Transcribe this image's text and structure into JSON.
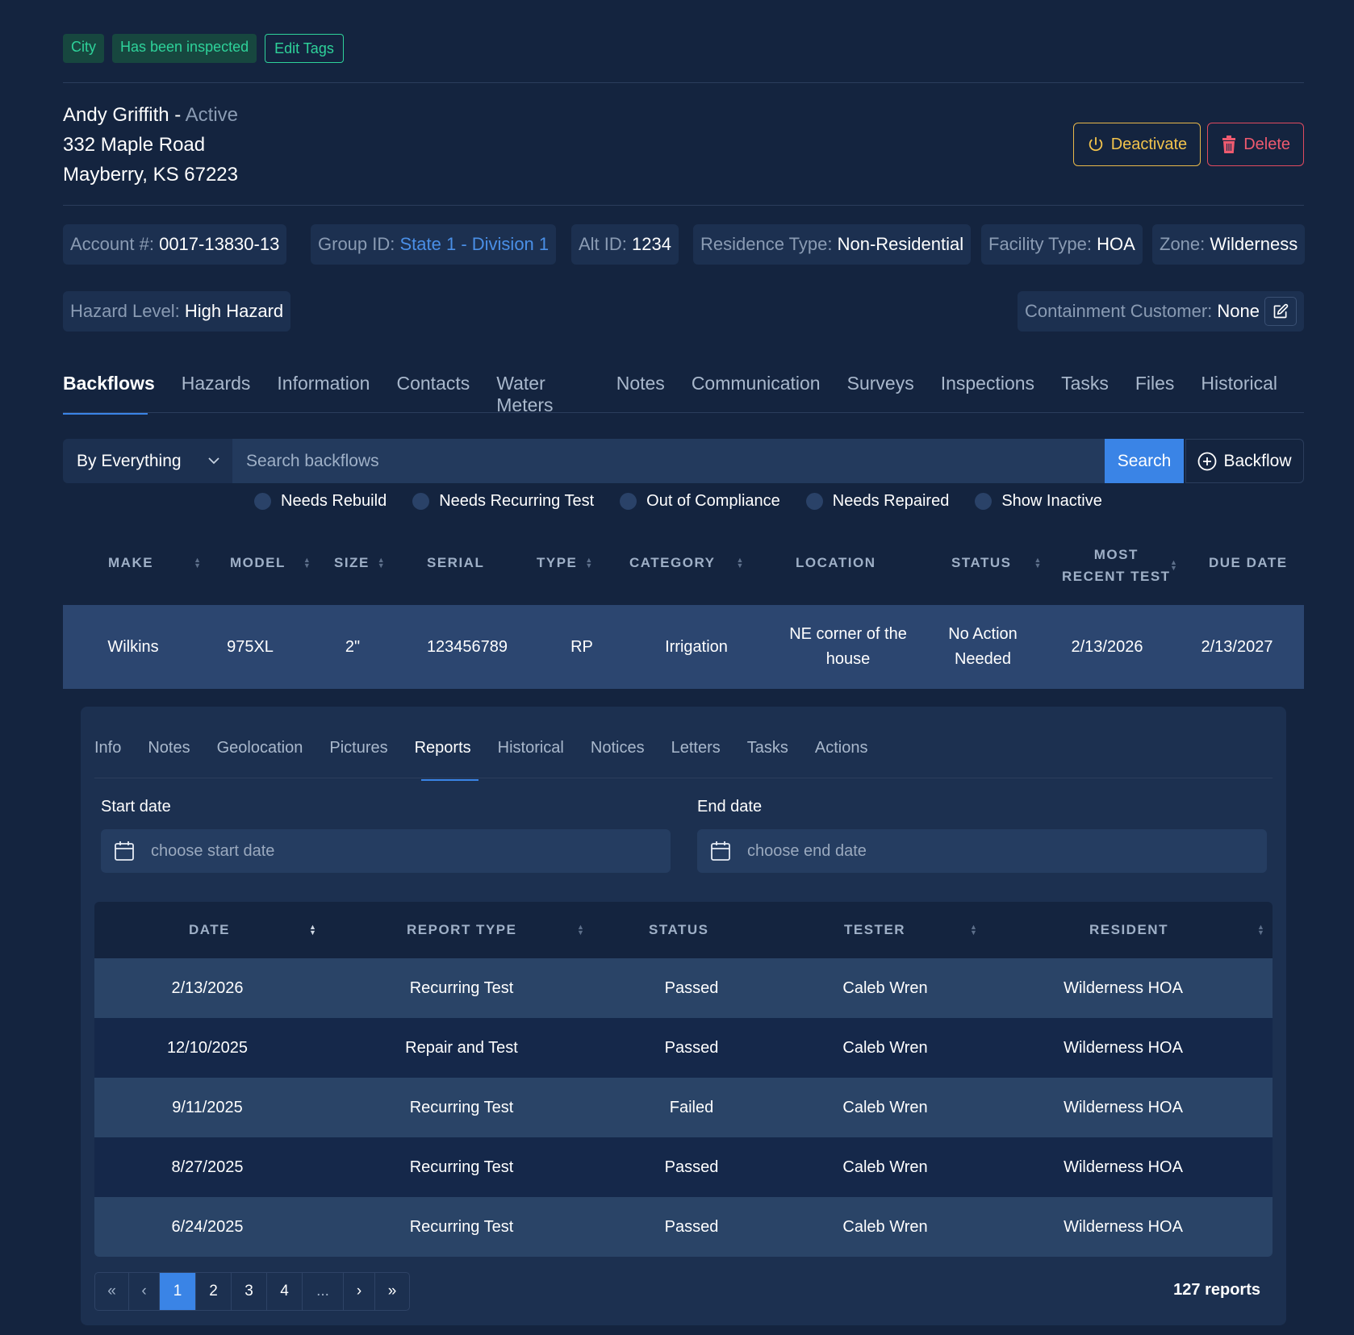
{
  "tags": {
    "items": [
      "City",
      "Has been inspected"
    ],
    "edit_label": "Edit Tags"
  },
  "customer": {
    "name": "Andy Griffith",
    "separator": " - ",
    "status": "Active",
    "address1": "332 Maple Road",
    "address2": "Mayberry, KS 67223"
  },
  "actions": {
    "deactivate": "Deactivate",
    "delete": "Delete"
  },
  "info": {
    "account": {
      "k": "Account #:",
      "v": "0017-13830-13"
    },
    "group": {
      "k": "Group ID:",
      "v": "State 1 - Division 1"
    },
    "alt": {
      "k": "Alt ID:",
      "v": "1234"
    },
    "residence": {
      "k": "Residence Type:",
      "v": "Non-Residential"
    },
    "facility": {
      "k": "Facility Type:",
      "v": "HOA"
    },
    "zone": {
      "k": "Zone:",
      "v": "Wilderness"
    },
    "hazard": {
      "k": "Hazard Level:",
      "v": "High Hazard"
    },
    "containment": {
      "k": "Containment Customer:",
      "v": "None"
    }
  },
  "main_tabs": [
    "Backflows",
    "Hazards",
    "Information",
    "Contacts",
    "Water Meters",
    "Notes",
    "Communication",
    "Surveys",
    "Inspections",
    "Tasks",
    "Files",
    "Historical"
  ],
  "search": {
    "filter_by": "By Everything",
    "placeholder": "Search backflows",
    "button": "Search",
    "add_label": "Backflow"
  },
  "filters": [
    "Needs Rebuild",
    "Needs Recurring Test",
    "Out of Compliance",
    "Needs Repaired",
    "Show Inactive"
  ],
  "backflow_table": {
    "headers": [
      "MAKE",
      "MODEL",
      "SIZE",
      "SERIAL",
      "TYPE",
      "CATEGORY",
      "LOCATION",
      "STATUS",
      "MOST",
      "RECENT TEST",
      "DUE DATE"
    ],
    "row": {
      "make": "Wilkins",
      "model": "975XL",
      "size": "2\"",
      "serial": "123456789",
      "type": "RP",
      "category": "Irrigation",
      "location1": "NE corner of the",
      "location2": "house",
      "status1": "No Action",
      "status2": "Needed",
      "recent": "2/13/2026",
      "due": "2/13/2027"
    }
  },
  "sub_tabs": [
    "Info",
    "Notes",
    "Geolocation",
    "Pictures",
    "Reports",
    "Historical",
    "Notices",
    "Letters",
    "Tasks",
    "Actions"
  ],
  "dates": {
    "start_label": "Start date",
    "start_placeholder": "choose start date",
    "end_label": "End date",
    "end_placeholder": "choose end date"
  },
  "reports": {
    "headers": [
      "DATE",
      "REPORT TYPE",
      "STATUS",
      "TESTER",
      "RESIDENT"
    ],
    "rows": [
      {
        "date": "2/13/2026",
        "type": "Recurring Test",
        "status": "Passed",
        "tester": "Caleb Wren",
        "resident": "Wilderness HOA"
      },
      {
        "date": "12/10/2025",
        "type": "Repair and Test",
        "status": "Passed",
        "tester": "Caleb Wren",
        "resident": "Wilderness HOA"
      },
      {
        "date": "9/11/2025",
        "type": "Recurring Test",
        "status": "Failed",
        "tester": "Caleb Wren",
        "resident": "Wilderness HOA"
      },
      {
        "date": "8/27/2025",
        "type": "Recurring Test",
        "status": "Passed",
        "tester": "Caleb Wren",
        "resident": "Wilderness HOA"
      },
      {
        "date": "6/24/2025",
        "type": "Recurring Test",
        "status": "Passed",
        "tester": "Caleb Wren",
        "resident": "Wilderness HOA"
      }
    ],
    "count": "127 reports"
  },
  "pager": {
    "first": "«",
    "prev": "‹",
    "pages": [
      "1",
      "2",
      "3",
      "4"
    ],
    "ellipsis": "...",
    "next": "›",
    "last": "»"
  },
  "colors": {
    "accent": "#3a84e6",
    "tag_green": "#2ed29a",
    "warn": "#f2c34c",
    "danger": "#ee5a6f",
    "bg": "#14243f"
  }
}
